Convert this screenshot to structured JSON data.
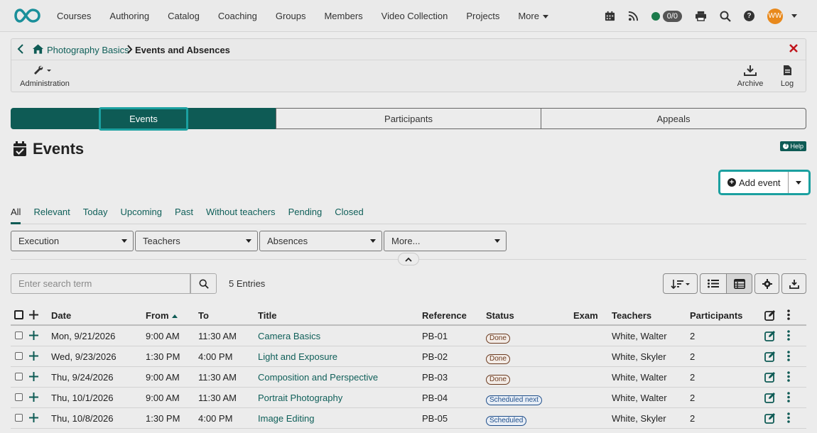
{
  "nav": {
    "links": [
      "Courses",
      "Authoring",
      "Catalog",
      "Coaching",
      "Groups",
      "Members",
      "Video Collection",
      "Projects"
    ],
    "more_label": "More",
    "count": "0/0",
    "avatar_initials": "WW"
  },
  "breadcrumb": {
    "course": "Photography Basics",
    "current": "Events and Absences"
  },
  "tools": {
    "administration": "Administration",
    "archive": "Archive",
    "log": "Log"
  },
  "segment_tabs": [
    "Events",
    "Participants",
    "Appeals"
  ],
  "page": {
    "title": "Events",
    "help_label": "Help",
    "add_event_label": "Add event"
  },
  "filter_tabs": [
    "All",
    "Relevant",
    "Today",
    "Upcoming",
    "Past",
    "Without teachers",
    "Pending",
    "Closed"
  ],
  "filters": [
    "Execution",
    "Teachers",
    "Absences",
    "More..."
  ],
  "search": {
    "placeholder": "Enter search term",
    "entries": "5 Entries"
  },
  "table": {
    "headers": {
      "date": "Date",
      "from": "From",
      "to": "To",
      "title": "Title",
      "reference": "Reference",
      "status": "Status",
      "exam": "Exam",
      "teachers": "Teachers",
      "participants": "Participants"
    },
    "rows": [
      {
        "date": "Mon, 9/21/2026",
        "from": "9:00 AM",
        "to": "11:30 AM",
        "title": "Camera Basics",
        "reference": "PB-01",
        "status": "Done",
        "teachers": "White, Walter",
        "participants": "2"
      },
      {
        "date": "Wed, 9/23/2026",
        "from": "1:30 PM",
        "to": "4:00 PM",
        "title": "Light and Exposure",
        "reference": "PB-02",
        "status": "Done",
        "teachers": "White, Skyler",
        "participants": "2"
      },
      {
        "date": "Thu, 9/24/2026",
        "from": "9:00 AM",
        "to": "11:30 AM",
        "title": "Composition and Perspective",
        "reference": "PB-03",
        "status": "Done",
        "teachers": "White, Walter",
        "participants": "2"
      },
      {
        "date": "Thu, 10/1/2026",
        "from": "9:00 AM",
        "to": "11:30 AM",
        "title": "Portrait Photography",
        "reference": "PB-04",
        "status": "Scheduled next",
        "teachers": "White, Walter",
        "participants": "2"
      },
      {
        "date": "Thu, 10/8/2026",
        "from": "1:30 PM",
        "to": "4:00 PM",
        "title": "Image Editing",
        "reference": "PB-05",
        "status": "Scheduled",
        "teachers": "White, Skyler",
        "participants": "2"
      }
    ]
  },
  "colors": {
    "accent": "#0e5b55",
    "focus": "#1ba0a0",
    "logo": "#1a8f9a",
    "close": "#c0141b",
    "avatar": "#e8891c",
    "online": "#1b7a4b"
  }
}
